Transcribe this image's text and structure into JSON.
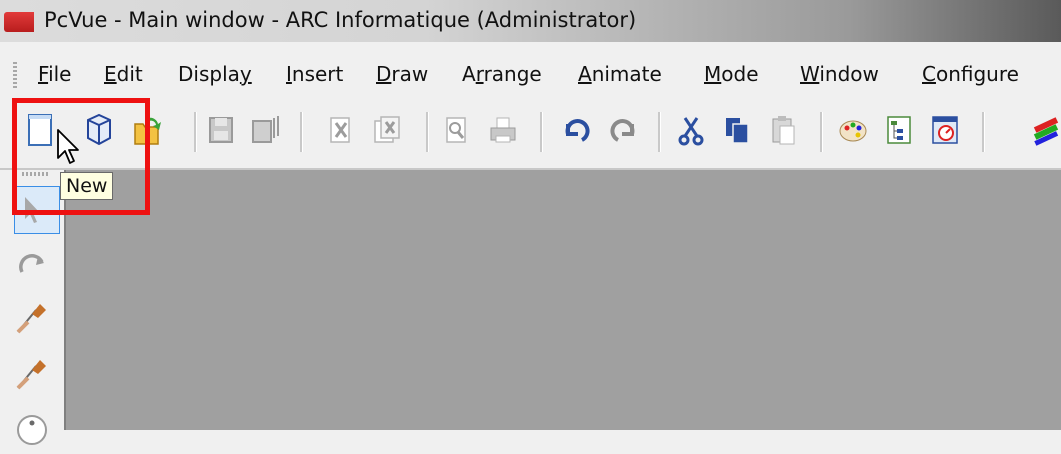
{
  "window": {
    "title": "PcVue - Main window - ARC Informatique (Administrator)"
  },
  "menu": {
    "items": [
      {
        "pre": "",
        "u": "F",
        "post": "ile"
      },
      {
        "pre": "",
        "u": "E",
        "post": "dit"
      },
      {
        "pre": "Displa",
        "u": "y",
        "post": ""
      },
      {
        "pre": "",
        "u": "I",
        "post": "nsert"
      },
      {
        "pre": "",
        "u": "D",
        "post": "raw"
      },
      {
        "pre": "A",
        "u": "r",
        "post": "range"
      },
      {
        "pre": "",
        "u": "A",
        "post": "nimate"
      },
      {
        "pre": "",
        "u": "M",
        "post": "ode"
      },
      {
        "pre": "",
        "u": "W",
        "post": "indow"
      },
      {
        "pre": "",
        "u": "C",
        "post": "onfigure"
      }
    ]
  },
  "tooltip": {
    "text": "New"
  },
  "colors": {
    "highlight": "#ee1111",
    "canvas": "#a0a0a0",
    "tooltip_bg": "#ffffe1"
  }
}
